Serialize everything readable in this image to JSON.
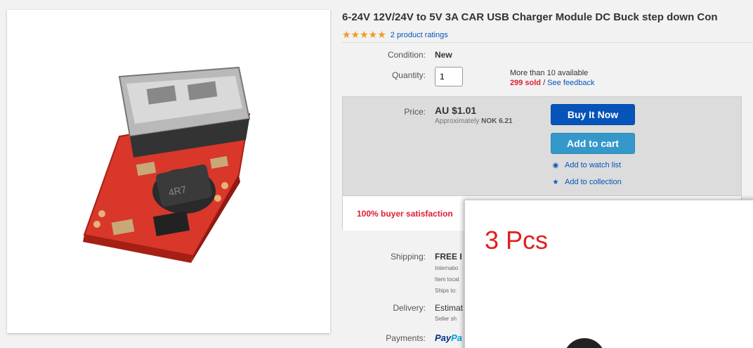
{
  "product": {
    "title": "6-24V 12V/24V to 5V 3A CAR USB Charger Module DC Buck step down Con",
    "stars": "★★★★★",
    "ratings_link": "2 product ratings"
  },
  "condition": {
    "label": "Condition:",
    "value": "New"
  },
  "quantity": {
    "label": "Quantity:",
    "value": "1",
    "available": "More than 10 available",
    "sold": "299 sold",
    "separator": "/",
    "feedback_link": "See feedback"
  },
  "price": {
    "label": "Price:",
    "value": "AU $1.01",
    "approx_prefix": "Approximately",
    "approx_value": "NOK 6.21"
  },
  "actions": {
    "buy_now": "Buy It Now",
    "add_to_cart": "Add to cart",
    "watch_list": "Add to watch list",
    "collection": "Add to collection"
  },
  "satisfaction": "100% buyer satisfaction",
  "shipping": {
    "label": "Shipping:",
    "value": "FREE I",
    "line1": "Internatio",
    "line2": "Item locat",
    "line3": "Ships to:"
  },
  "delivery": {
    "label": "Delivery:",
    "value": "Estimat",
    "sub": "Seller sh"
  },
  "payments": {
    "label": "Payments:",
    "paypal_a": "Pay",
    "paypal_b": "Pa"
  },
  "overlay": {
    "text": "3 Pcs"
  },
  "colors": {
    "buy_button": "#0654ba",
    "cart_button": "#3498ca",
    "link": "#0654ba",
    "sold": "#dd1e31",
    "stars": "#f29a1e"
  },
  "icons": {
    "watch": "eye-icon",
    "collection": "star-icon"
  }
}
